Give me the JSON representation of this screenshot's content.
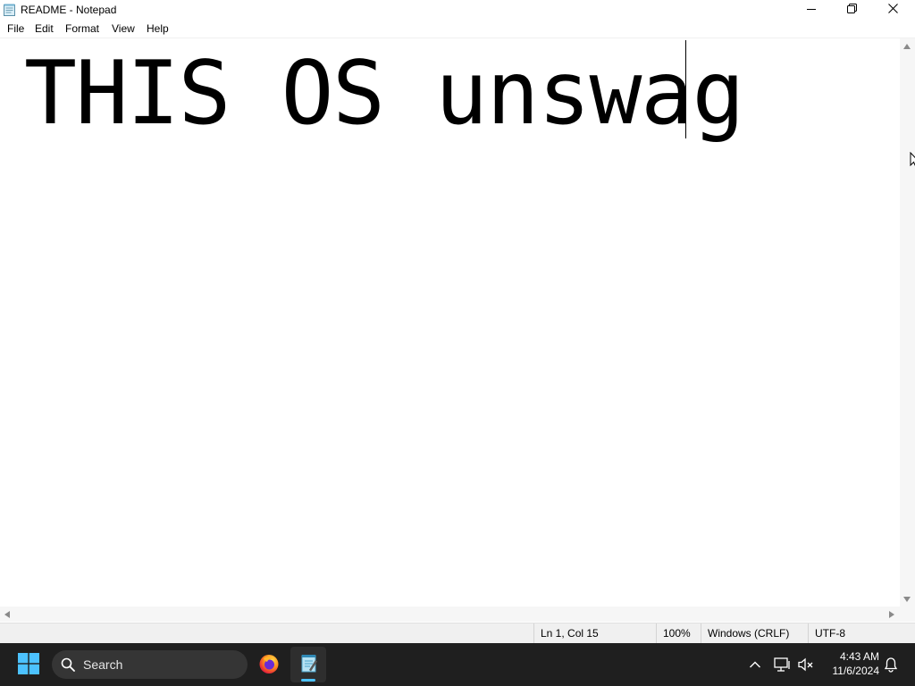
{
  "window": {
    "title": "README - Notepad",
    "app_icon": "notepad-icon",
    "controls": {
      "minimize_icon": "minimize-icon",
      "maximize_icon": "restore-icon",
      "close_icon": "close-icon"
    }
  },
  "menu": {
    "items": [
      {
        "label": "File"
      },
      {
        "label": "Edit"
      },
      {
        "label": "Format"
      },
      {
        "label": "View"
      },
      {
        "label": "Help"
      }
    ]
  },
  "editor": {
    "content": "THIS OS unswag"
  },
  "status": {
    "position": "Ln 1, Col 15",
    "zoom": "100%",
    "line_ending": "Windows (CRLF)",
    "encoding": "UTF-8"
  },
  "taskbar": {
    "start_icon": "windows-start-icon",
    "search_placeholder": "Search",
    "apps": [
      {
        "name": "Firefox",
        "icon": "firefox-icon"
      },
      {
        "name": "Notepad",
        "icon": "notepad-icon",
        "active": true
      }
    ],
    "tray": {
      "overflow_icon": "chevron-up-icon",
      "network_icon": "network-icon",
      "volume_icon": "volume-muted-icon",
      "notification_icon": "bell-icon"
    },
    "clock": {
      "time": "4:43 AM",
      "date": "11/6/2024"
    }
  },
  "colors": {
    "taskbar_bg": "#1f1f1f",
    "accent": "#4cc2ff",
    "statusbar_bg": "#f0f0f0"
  }
}
